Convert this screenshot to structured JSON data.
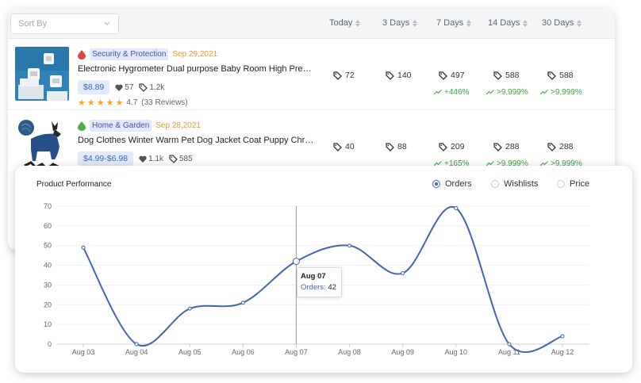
{
  "list": {
    "sort_placeholder": "Sort By",
    "columns": [
      "Today",
      "3 Days",
      "7 Days",
      "14 Days",
      "30 Days"
    ],
    "products": [
      {
        "category": "Security & Protection",
        "date": "Sep 29,2021",
        "title": "Electronic Hygrometer Dual purpose Baby Room High Precision ...",
        "price": "$8.89",
        "likes": "57",
        "sold": "1.2k",
        "rating": "4.7",
        "reviews": "(33 Reviews)",
        "metrics": [
          "72",
          "140",
          "497",
          "588",
          "588"
        ],
        "growth": [
          "+446%",
          ">9,999%",
          ">9,999%"
        ],
        "category_color": "#e0483b"
      },
      {
        "category": "Home & Garden",
        "date": "Sep 28,2021",
        "title": "Dog Clothes Winter Warm Pet Dog Jacket Coat Puppy Christmas ...",
        "price": "$4.99-$6.98",
        "likes": "1.1k",
        "sold": "585",
        "metrics": [
          "40",
          "88",
          "209",
          "288",
          "288"
        ],
        "growth": [
          "+165%",
          ">9,999%",
          ">9,999%"
        ],
        "category_color": "#47b24a"
      }
    ]
  },
  "chart_panel": {
    "title": "Product Performance",
    "legend": [
      {
        "label": "Orders",
        "selected": true
      },
      {
        "label": "Wishlists",
        "selected": false
      },
      {
        "label": "Price",
        "selected": false
      }
    ],
    "tooltip": {
      "date": "Aug 07",
      "label": "Orders:",
      "value": "42"
    }
  },
  "chart_data": {
    "type": "line",
    "x": [
      "Aug 03",
      "Aug 04",
      "Aug 05",
      "Aug 06",
      "Aug 07",
      "Aug 08",
      "Aug 09",
      "Aug 10",
      "Aug 11",
      "Aug 12"
    ],
    "series": [
      {
        "name": "Orders",
        "values": [
          49,
          0,
          18,
          21,
          42,
          50,
          36,
          69,
          0,
          4
        ]
      }
    ],
    "yticks": [
      0,
      10,
      20,
      30,
      40,
      50,
      60,
      70
    ],
    "ylim": [
      0,
      70
    ],
    "grid": true,
    "line_color": "#4265b0",
    "hover_index": 4
  }
}
